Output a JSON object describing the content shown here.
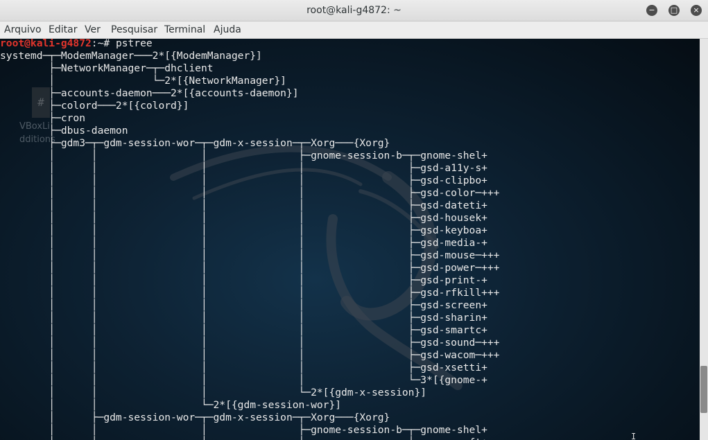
{
  "window": {
    "title": "root@kali-g4872: ~",
    "controls": {
      "minimize": "−",
      "maximize": "□",
      "close": "×"
    }
  },
  "menubar": {
    "items": [
      "Arquivo",
      "Editar",
      "Ver",
      "Pesquisar",
      "Terminal",
      "Ajuda"
    ]
  },
  "desktop": {
    "icon_glyph": "#",
    "labels": [
      "VBoxLi",
      "dditions"
    ]
  },
  "terminal": {
    "prompt": {
      "user_host": "root@kali-g4872",
      "path": ":~# ",
      "command": "pstree"
    },
    "lines": [
      "systemd─┬─ModemManager───2*[{ModemManager}]",
      "        ├─NetworkManager─┬─dhclient",
      "        │                └─2*[{NetworkManager}]",
      "        ├─accounts-daemon───2*[{accounts-daemon}]",
      "        ├─colord───2*[{colord}]",
      "        ├─cron",
      "        ├─dbus-daemon",
      "        ├─gdm3─┬─gdm-session-wor─┬─gdm-x-session─┬─Xorg───{Xorg}",
      "        │      │                 │               ├─gnome-session-b─┬─gnome-shel+",
      "        │      │                 │               │                 ├─gsd-a11y-s+",
      "        │      │                 │               │                 ├─gsd-clipbo+",
      "        │      │                 │               │                 ├─gsd-color─+++",
      "        │      │                 │               │                 ├─gsd-dateti+",
      "        │      │                 │               │                 ├─gsd-housek+",
      "        │      │                 │               │                 ├─gsd-keyboa+",
      "        │      │                 │               │                 ├─gsd-media-+",
      "        │      │                 │               │                 ├─gsd-mouse─+++",
      "        │      │                 │               │                 ├─gsd-power─+++",
      "        │      │                 │               │                 ├─gsd-print-+",
      "        │      │                 │               │                 ├─gsd-rfkill+++",
      "        │      │                 │               │                 ├─gsd-screen+",
      "        │      │                 │               │                 ├─gsd-sharin+",
      "        │      │                 │               │                 ├─gsd-smartc+",
      "        │      │                 │               │                 ├─gsd-sound─+++",
      "        │      │                 │               │                 ├─gsd-wacom─+++",
      "        │      │                 │               │                 ├─gsd-xsetti+",
      "        │      │                 │               │                 └─3*[{gnome-+",
      "        │      │                 │               └─2*[{gdm-x-session}]",
      "        │      │                 └─2*[{gdm-session-wor}]",
      "        │      ├─gdm-session-wor─┬─gdm-x-session─┬─Xorg───{Xorg}",
      "        │      │                 │               ├─gnome-session-b─┬─gnome-shel+",
      "        │      │                 │               │                 ├─gnome-soft+"
    ]
  },
  "colors": {
    "prompt_user": "#e3352c",
    "terminal_text": "#e9e9e9",
    "terminal_bg": "#0b1620"
  }
}
